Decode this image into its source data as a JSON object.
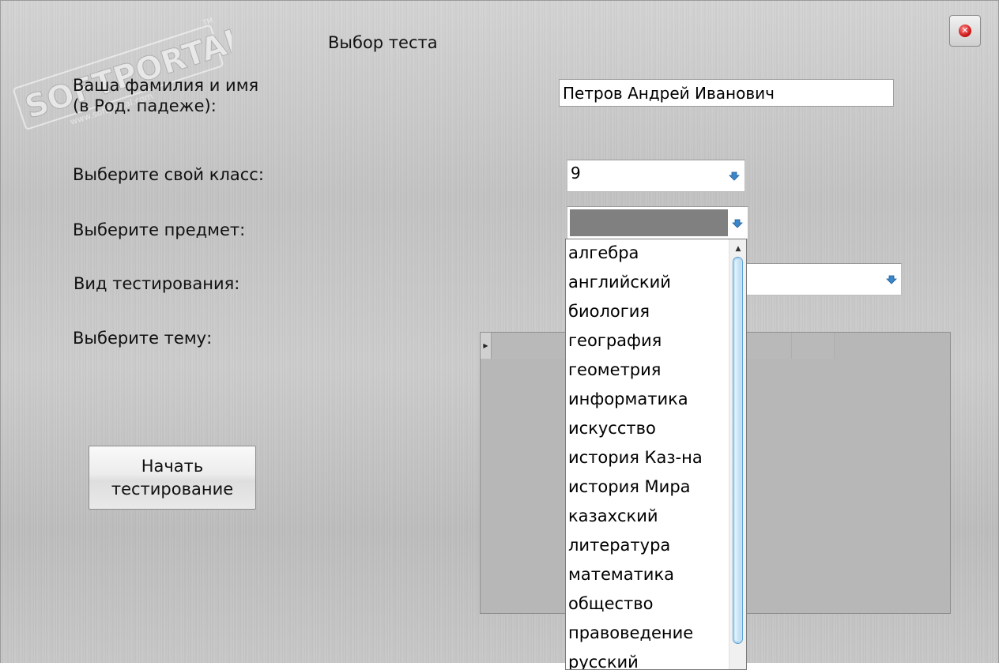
{
  "window": {
    "title": "Выбор теста"
  },
  "watermark": {
    "brand": "SOFTPORTAL",
    "site": "www.softportal.com",
    "trademark": "TM"
  },
  "labels": {
    "name_line1": "Ваша фамилия и имя",
    "name_line2": "(в Род. падеже):",
    "class": "Выберите свой класс:",
    "subject": "Выберите предмет:",
    "test_type": "Вид тестирования:",
    "topic": "Выберите тему:"
  },
  "name_field": {
    "value": "Петров Андрей Иванович"
  },
  "class_combo": {
    "value": "9",
    "icon": "chevron-down-icon"
  },
  "subject_combo": {
    "value": "",
    "icon": "chevron-down-icon"
  },
  "test_type_combo": {
    "value": "",
    "icon": "chevron-down-icon"
  },
  "subject_dropdown": {
    "items": [
      "алгебра",
      "английский",
      "биология",
      "география",
      "геометрия",
      "информатика",
      "искусство",
      "история Каз-на",
      "история Мира",
      "казахский",
      "литература",
      "математика",
      "общество",
      "правоведение",
      "русский"
    ]
  },
  "start_button": {
    "line1": "Начать",
    "line2": "тестирование"
  },
  "close_button": {
    "icon": "close-icon",
    "glyph": "✕"
  },
  "topics_panel": {
    "row_indicator_glyph": "▶"
  },
  "colors": {
    "selection": "#808080",
    "scroll_thumb": "#a8d1ef",
    "arrow_blue": "#3a86c8"
  }
}
